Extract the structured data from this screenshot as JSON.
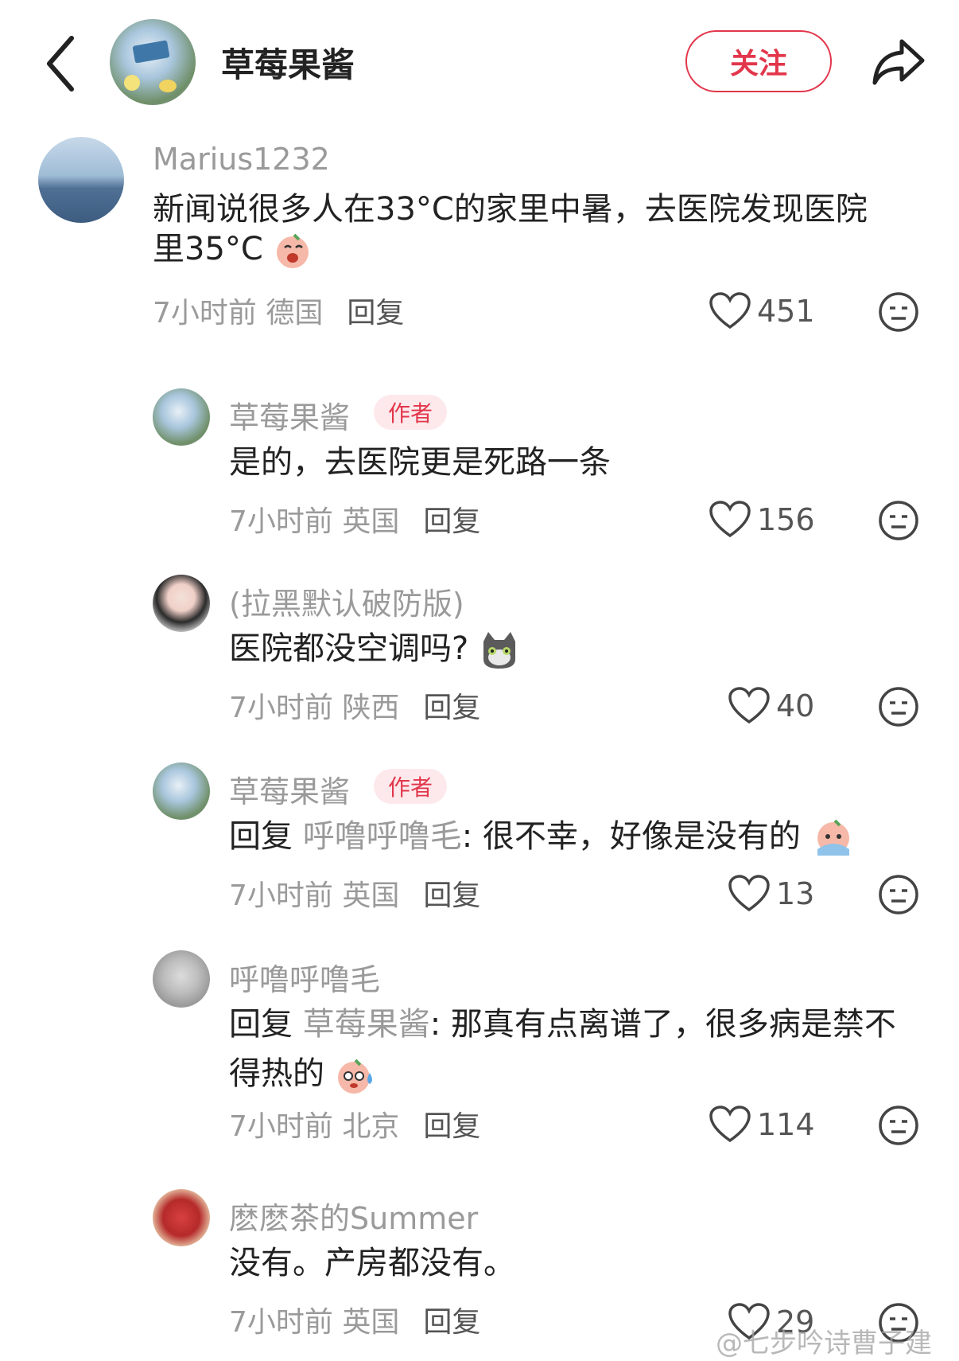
{
  "header": {
    "back_icon": "chevron-left-icon",
    "name": "草莓果酱",
    "follow_label": "关注",
    "share_icon": "share-arrow-icon"
  },
  "comments": [
    {
      "user": "Marius1232",
      "text_lines": [
        "新闻说很多人在33°C的家里中暑，去医院发现医院",
        "里35°C"
      ],
      "emoji": "crying-face-emoji",
      "time": "7小时前",
      "location": "德国",
      "reply_label": "回复",
      "likes": "451"
    },
    {
      "user": "草莓果酱",
      "badge": "作者",
      "text": "是的，去医院更是死路一条",
      "time": "7小时前",
      "location": "英国",
      "reply_label": "回复",
      "likes": "156"
    },
    {
      "user": "(拉黑默认破防版)",
      "text": "医院都没空调吗?",
      "emoji": "cat-face-emoji",
      "time": "7小时前",
      "location": "陕西",
      "reply_label": "回复",
      "likes": "40"
    },
    {
      "user": "草莓果酱",
      "badge": "作者",
      "reply_prefix": "回复",
      "mention": "呼噜呼噜毛",
      "text": ": 很不幸，好像是没有的",
      "emoji": "crying-face-emoji",
      "time": "7小时前",
      "location": "英国",
      "reply_label": "回复",
      "likes": "13"
    },
    {
      "user": "呼噜呼噜毛",
      "reply_prefix": "回复",
      "mention": "草莓果酱",
      "text": ": 那真有点离谱了，很多病是禁不",
      "text_line2": "得热的",
      "emoji": "sweating-face-emoji",
      "time": "7小时前",
      "location": "北京",
      "reply_label": "回复",
      "likes": "114"
    },
    {
      "user": "麽麽茶的Summer",
      "text": "没有。产房都没有。",
      "time": "7小时前",
      "location": "英国",
      "reply_label": "回复",
      "likes": "29"
    }
  ],
  "watermark": "@七步吟诗曹子建",
  "colors": {
    "accent": "#e2364b",
    "muted": "#9a9a9a",
    "badge_bg": "#fde9ec"
  }
}
